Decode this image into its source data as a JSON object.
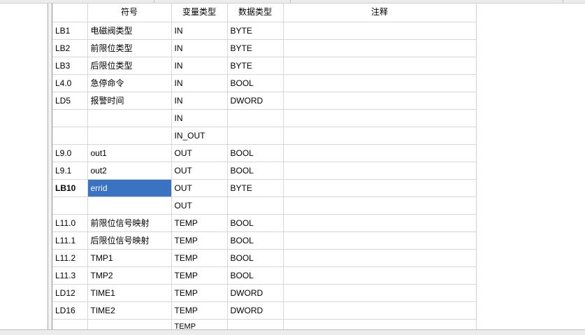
{
  "table": {
    "headers": {
      "symbol": "符号",
      "var_type": "变量类型",
      "data_type": "数据类型",
      "comment": "注释"
    },
    "rows": [
      {
        "addr": "LB1",
        "symbol": "电磁阀类型",
        "var_type": "IN",
        "data_type": "BYTE",
        "comment": ""
      },
      {
        "addr": "LB2",
        "symbol": "前限位类型",
        "var_type": "IN",
        "data_type": "BYTE",
        "comment": ""
      },
      {
        "addr": "LB3",
        "symbol": "后限位类型",
        "var_type": "IN",
        "data_type": "BYTE",
        "comment": ""
      },
      {
        "addr": "L4.0",
        "symbol": "急停命令",
        "var_type": "IN",
        "data_type": "BOOL",
        "comment": ""
      },
      {
        "addr": "LD5",
        "symbol": "报警时间",
        "var_type": "IN",
        "data_type": "DWORD",
        "comment": ""
      },
      {
        "addr": "",
        "symbol": "",
        "var_type": "IN",
        "data_type": "",
        "comment": ""
      },
      {
        "addr": "",
        "symbol": "",
        "var_type": "IN_OUT",
        "data_type": "",
        "comment": ""
      },
      {
        "addr": "L9.0",
        "symbol": "out1",
        "var_type": "OUT",
        "data_type": "BOOL",
        "comment": ""
      },
      {
        "addr": "L9.1",
        "symbol": "out2",
        "var_type": "OUT",
        "data_type": "BOOL",
        "comment": ""
      },
      {
        "addr": "LB10",
        "symbol": "errid",
        "var_type": "OUT",
        "data_type": "BYTE",
        "comment": ""
      },
      {
        "addr": "",
        "symbol": "",
        "var_type": "OUT",
        "data_type": "",
        "comment": ""
      },
      {
        "addr": "L11.0",
        "symbol": "前限位信号映射",
        "var_type": "TEMP",
        "data_type": "BOOL",
        "comment": ""
      },
      {
        "addr": "L11.1",
        "symbol": "后限位信号映射",
        "var_type": "TEMP",
        "data_type": "BOOL",
        "comment": ""
      },
      {
        "addr": "L11.2",
        "symbol": "TMP1",
        "var_type": "TEMP",
        "data_type": "BOOL",
        "comment": ""
      },
      {
        "addr": "L11.3",
        "symbol": "TMP2",
        "var_type": "TEMP",
        "data_type": "BOOL",
        "comment": ""
      },
      {
        "addr": "LD12",
        "symbol": "TIME1",
        "var_type": "TEMP",
        "data_type": "DWORD",
        "comment": ""
      },
      {
        "addr": "LD16",
        "symbol": "TIME2",
        "var_type": "TEMP",
        "data_type": "DWORD",
        "comment": ""
      },
      {
        "addr": "",
        "symbol": "",
        "var_type": "TEMP",
        "data_type": "",
        "comment": ""
      }
    ]
  },
  "selection": {
    "row": "LB10",
    "column": "symbol",
    "color": "#3b73c4"
  }
}
